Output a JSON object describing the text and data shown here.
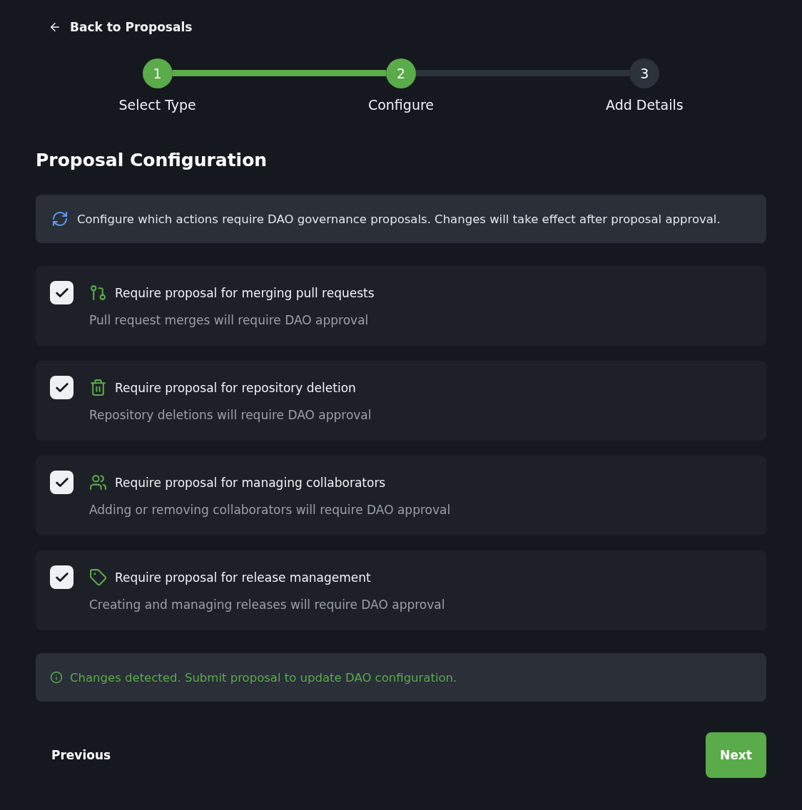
{
  "back_link": "Back to Proposals",
  "steps": [
    {
      "number": "1",
      "label": "Select Type",
      "reached": true
    },
    {
      "number": "2",
      "label": "Configure",
      "reached": true
    },
    {
      "number": "3",
      "label": "Add Details",
      "reached": false
    }
  ],
  "heading": "Proposal Configuration",
  "info_banner": "Configure which actions require DAO governance proposals. Changes will take effect after proposal approval.",
  "options": [
    {
      "title": "Require proposal for merging pull requests",
      "description": "Pull request merges will require DAO approval",
      "checked": true
    },
    {
      "title": "Require proposal for repository deletion",
      "description": "Repository deletions will require DAO approval",
      "checked": true
    },
    {
      "title": "Require proposal for managing collaborators",
      "description": "Adding or removing collaborators will require DAO approval",
      "checked": true
    },
    {
      "title": "Require proposal for release management",
      "description": "Creating and managing releases will require DAO approval",
      "checked": true
    }
  ],
  "notice": "Changes detected. Submit proposal to update DAO configuration.",
  "buttons": {
    "previous": "Previous",
    "next": "Next"
  }
}
